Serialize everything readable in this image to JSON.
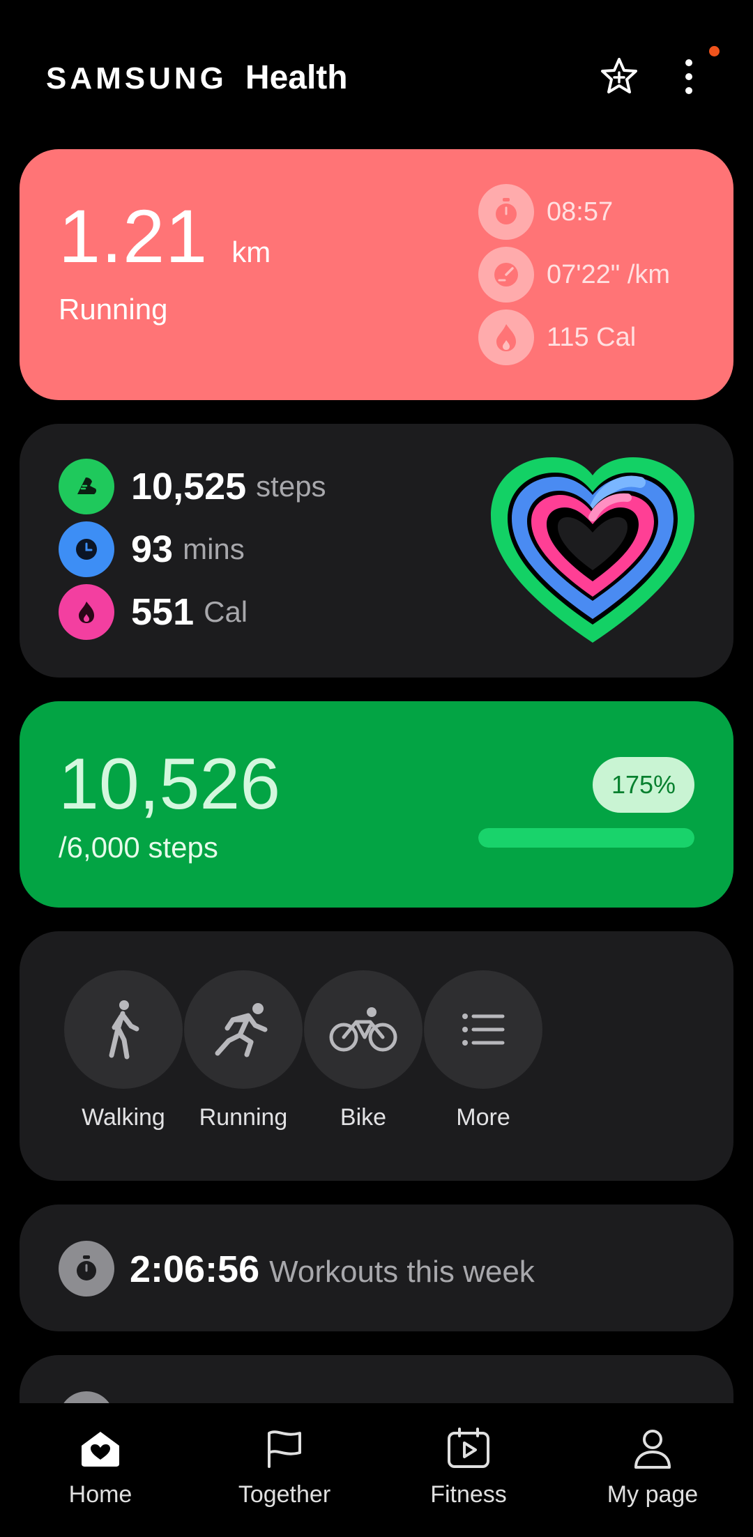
{
  "header": {
    "brand_samsung": "SAMSUNG",
    "brand_health": "Health",
    "star_icon": "star-icon",
    "more_icon": "more-vertical-icon",
    "notification_dot_color": "#f0531c"
  },
  "running_card": {
    "distance": "1.21",
    "distance_unit": "km",
    "activity": "Running",
    "color": "#ff7476",
    "stats": [
      {
        "icon": "stopwatch-icon",
        "text": "08:57"
      },
      {
        "icon": "pace-gauge-icon",
        "text": "07'22\" /km"
      },
      {
        "icon": "flame-icon",
        "text": "115 Cal"
      }
    ]
  },
  "activity_card": {
    "steps_value": "10,525",
    "steps_unit": "steps",
    "mins_value": "93",
    "mins_unit": "mins",
    "cal_value": "551",
    "cal_unit": "Cal",
    "colors": {
      "steps": "#1ed760",
      "mins": "#3d8ef5",
      "cal": "#f33fa0"
    }
  },
  "steps_card": {
    "value": "10,526",
    "goal": "/6,000 steps",
    "percent": "175%",
    "progress_fraction": 1.0,
    "color": "#03a444"
  },
  "workout_types": [
    {
      "label": "Walking",
      "icon": "walking-icon"
    },
    {
      "label": "Running",
      "icon": "running-icon"
    },
    {
      "label": "Bike",
      "icon": "bike-icon"
    },
    {
      "label": "More",
      "icon": "list-icon"
    }
  ],
  "workouts_week": {
    "value": "2:06:56",
    "label": "Workouts this week"
  },
  "bottom_nav": [
    {
      "label": "Home",
      "icon": "home-heart-icon",
      "active": true
    },
    {
      "label": "Together",
      "icon": "flag-icon",
      "active": false
    },
    {
      "label": "Fitness",
      "icon": "fitness-play-icon",
      "active": false
    },
    {
      "label": "My page",
      "icon": "person-icon",
      "active": false
    }
  ]
}
